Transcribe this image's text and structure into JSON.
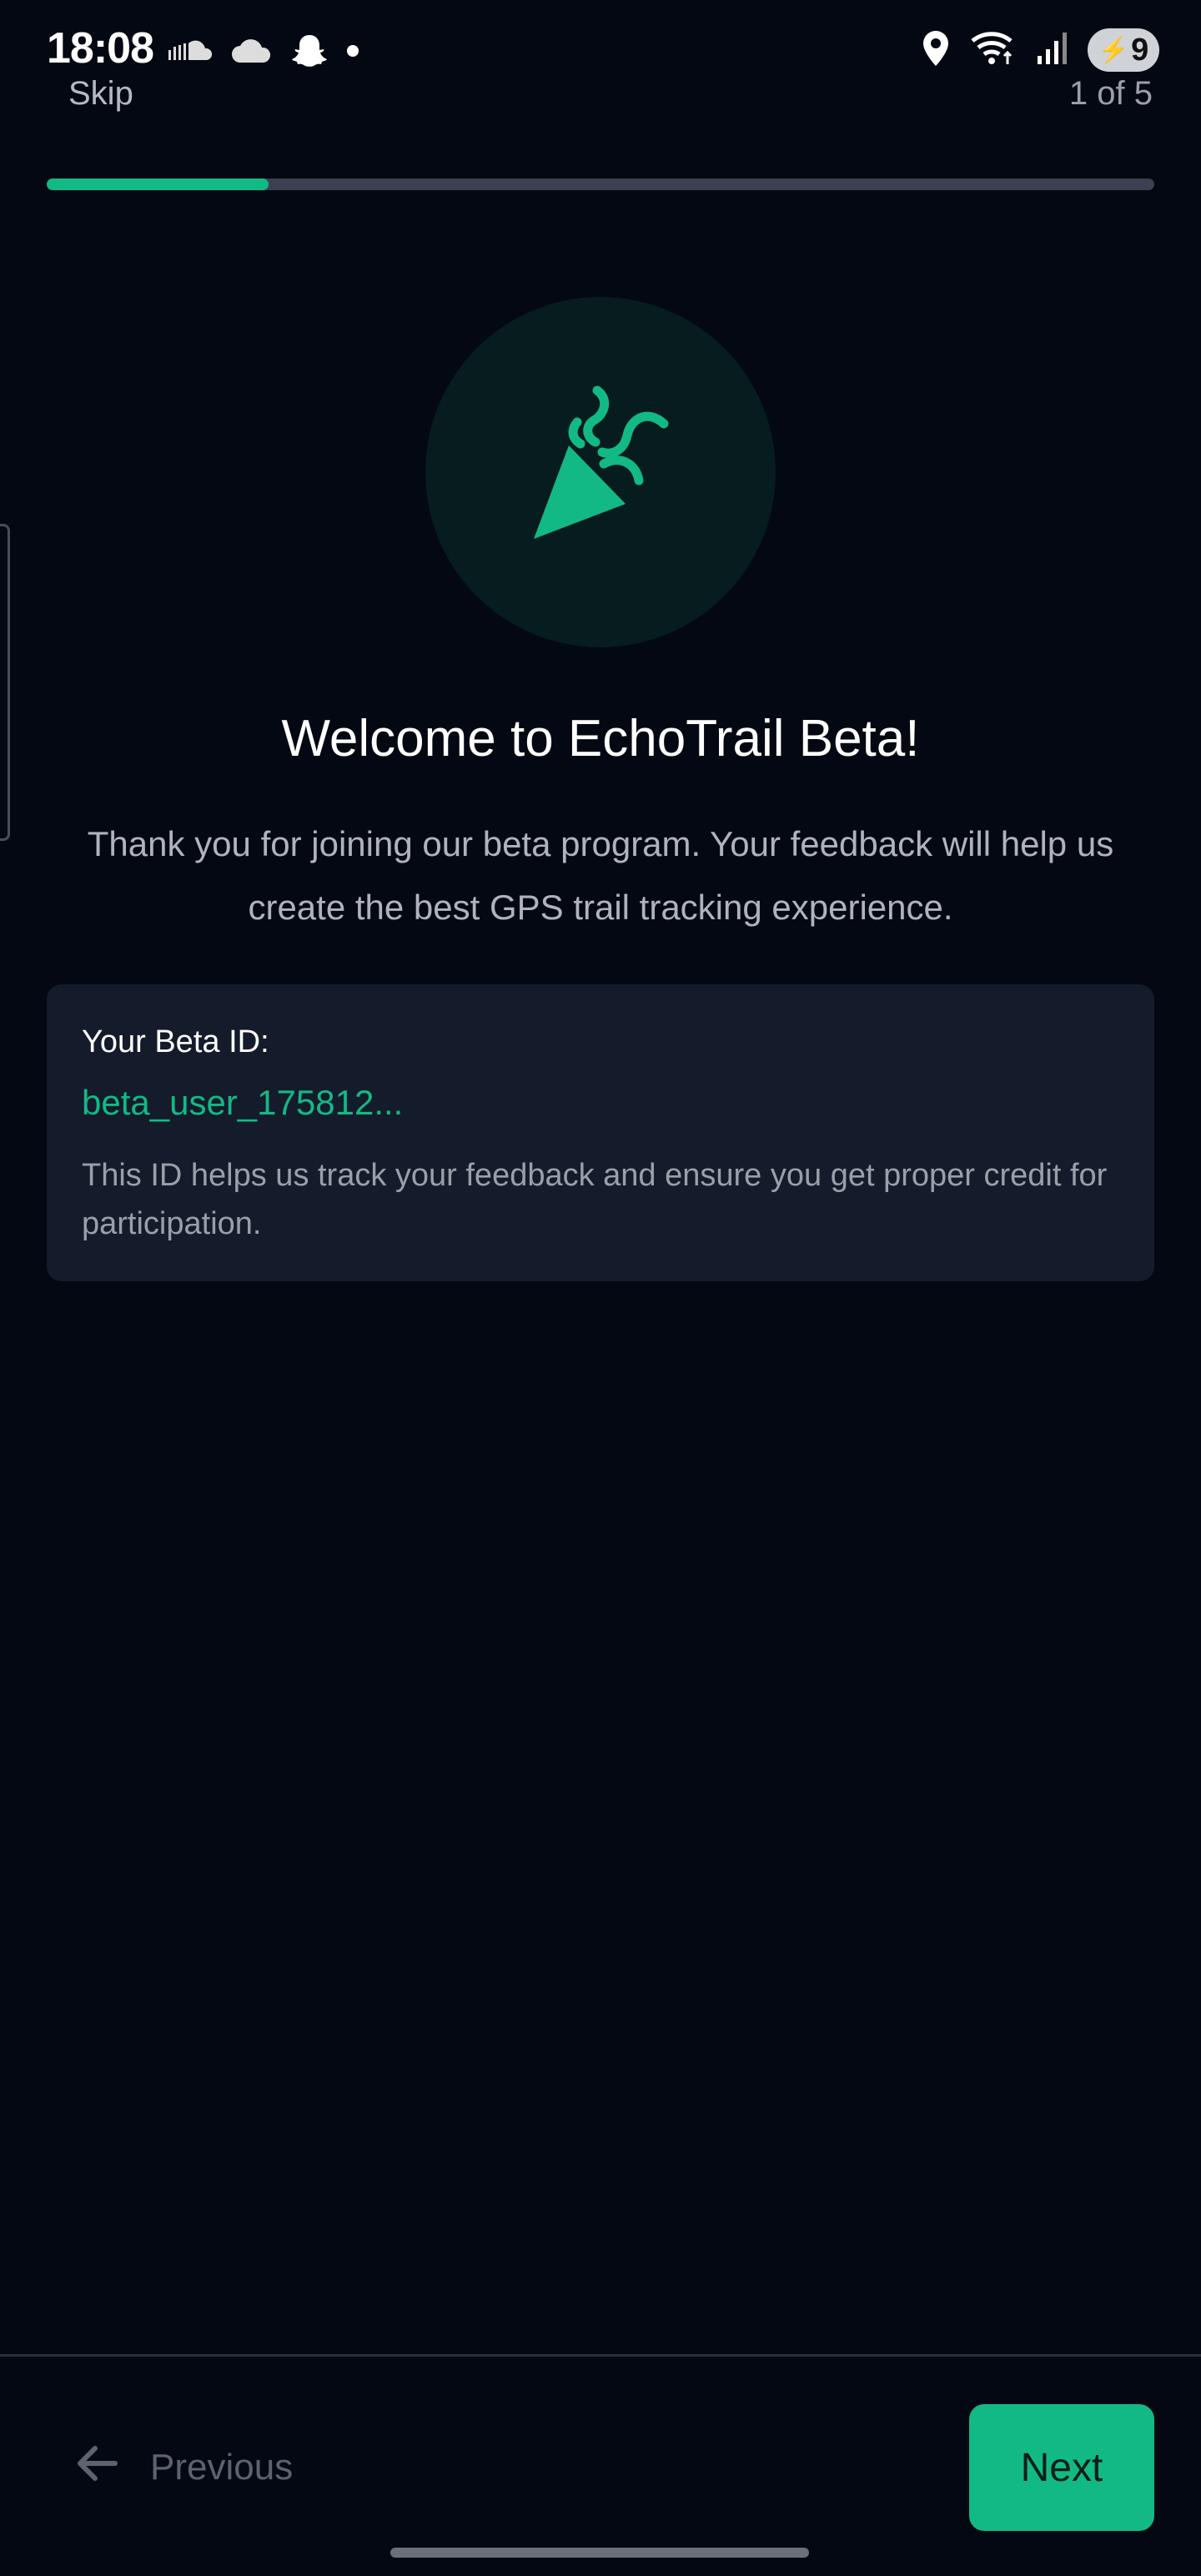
{
  "status_bar": {
    "time": "18:08",
    "battery_level": "9",
    "left_icons": [
      "soundcloud-icon",
      "cloud-icon",
      "snapchat-icon",
      "dot-icon"
    ],
    "right_icons": [
      "location-icon",
      "wifi-icon",
      "signal-icon",
      "battery-icon"
    ]
  },
  "header": {
    "skip_label": "Skip",
    "step_counter": "1 of 5"
  },
  "progress": {
    "fraction": 0.2,
    "fill_color": "#13b985",
    "track_color": "#3b4150"
  },
  "hero": {
    "icon": "party-popper-icon",
    "icon_color": "#13b985",
    "circle_color": "#061c1e"
  },
  "welcome": {
    "title": "Welcome to EchoTrail Beta!",
    "subtitle": "Thank you for joining our beta program. Your feedback will help us create the best GPS trail tracking experience."
  },
  "beta_card": {
    "label": "Your Beta ID:",
    "value": "beta_user_175812...",
    "description": "This ID helps us track your feedback and ensure you get proper credit for participation."
  },
  "footer": {
    "previous_label": "Previous",
    "next_label": "Next",
    "accent_color": "#13b985"
  }
}
